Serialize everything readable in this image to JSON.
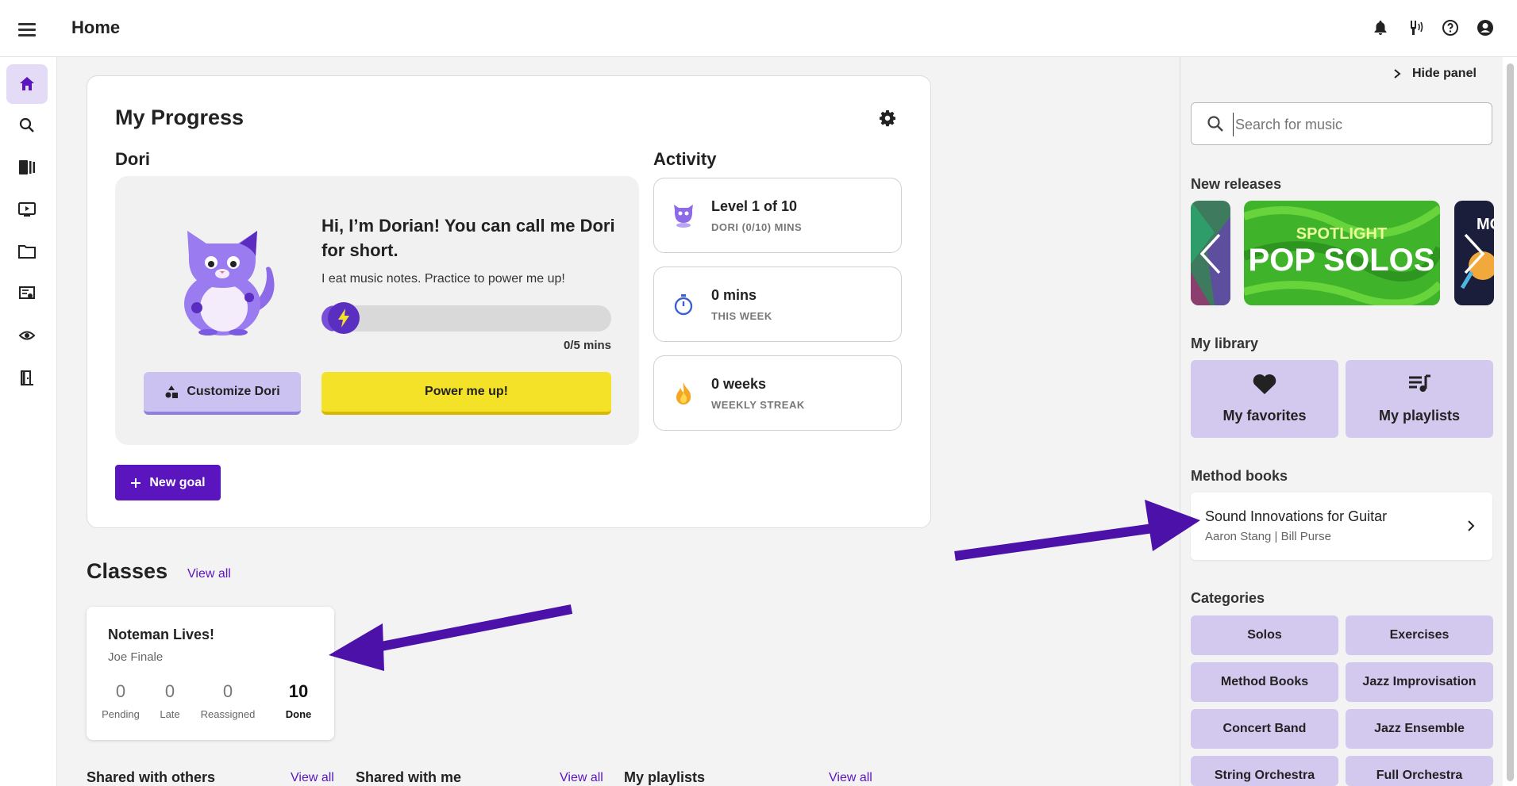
{
  "header": {
    "title": "Home"
  },
  "progress": {
    "title": "My Progress",
    "dori_label": "Dori",
    "dori_heading": "Hi, I’m Dorian! You can call me Dori for short.",
    "dori_subtext": "I eat music notes. Practice to power me up!",
    "progress_fraction": 0.06,
    "mins_text": "0/5 mins",
    "customize_label": "Customize Dori",
    "power_label": "Power me up!",
    "new_goal_label": "New goal",
    "activity_title": "Activity",
    "activity": [
      {
        "title": "Level 1 of 10",
        "sub": "DORI (0/10) MINS"
      },
      {
        "title": "0 mins",
        "sub": "THIS WEEK"
      },
      {
        "title": "0 weeks",
        "sub": "WEEKLY STREAK"
      }
    ]
  },
  "classes": {
    "title": "Classes",
    "view_all": "View all",
    "card": {
      "title": "Noteman Lives!",
      "teacher": "Joe Finale",
      "stats": [
        {
          "n": "0",
          "l": "Pending"
        },
        {
          "n": "0",
          "l": "Late"
        },
        {
          "n": "0",
          "l": "Reassigned"
        },
        {
          "n": "10",
          "l": "Done"
        }
      ]
    }
  },
  "sections": [
    {
      "title": "Shared with others",
      "view_all": "View all"
    },
    {
      "title": "Shared with me",
      "view_all": "View all"
    },
    {
      "title": "My playlists",
      "view_all": "View all"
    }
  ],
  "panel": {
    "hide_label": "Hide panel",
    "search_placeholder": "Search for music",
    "new_releases": "New releases",
    "spotlight_small": "SPOTLIGHT",
    "spotlight_big": "POP SOLOS",
    "tile_partial_text": "MO",
    "my_library": "My library",
    "favorites": "My favorites",
    "playlists": "My playlists",
    "method_books": "Method books",
    "method_title": "Sound Innovations for Guitar",
    "method_authors": "Aaron Stang | Bill Purse",
    "categories_title": "Categories",
    "categories": [
      "Solos",
      "Exercises",
      "Method Books",
      "Jazz Improvisation",
      "Concert Band",
      "Jazz Ensemble",
      "String Orchestra",
      "Full Orchestra"
    ]
  },
  "colors": {
    "accent": "#5b15bf",
    "lavender": "#d3c9ef",
    "yellow": "#f3e228",
    "arrow": "#4b11a8"
  },
  "icons": {
    "nav": [
      "home-icon",
      "search-icon",
      "library-icon",
      "video-icon",
      "folder-icon",
      "certificate-icon",
      "tuner-icon",
      "exit-icon"
    ]
  }
}
